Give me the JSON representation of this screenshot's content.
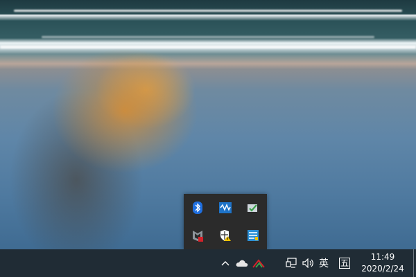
{
  "tray_popup": {
    "icons": [
      {
        "name": "bluetooth-icon"
      },
      {
        "name": "network-monitor-icon"
      },
      {
        "name": "shield-check-icon"
      },
      {
        "name": "mcafee-icon"
      },
      {
        "name": "windows-security-warning-icon"
      },
      {
        "name": "app-manager-icon"
      }
    ]
  },
  "taskbar": {
    "show_hidden_icons_glyph": "^",
    "input_language": "英",
    "ime_mode": "五",
    "clock": {
      "time": "11:49",
      "date": "2020/2/24"
    }
  },
  "colors": {
    "taskbar_bg": "#202c35",
    "popup_bg": "#2b2b2b",
    "bluetooth_blue": "#1f6fe0",
    "warning_yellow": "#f2c200",
    "mcafee_red": "#d3222a"
  }
}
